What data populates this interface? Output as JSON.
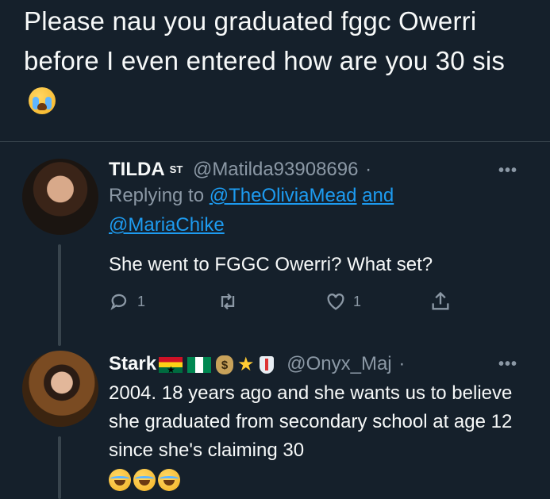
{
  "top_tweet": {
    "text": "Please nau you graduated fggc Owerri before I even entered how are you 30 sis"
  },
  "reply1": {
    "name": "TILDA",
    "badge": "ST",
    "handle": "@Matilda93908696",
    "dot": "·",
    "replying_prefix": "Replying to",
    "mention1": "@TheOliviaMead",
    "and_text": "and",
    "mention2": "@MariaChike",
    "text": "She went to FGGC Owerri? What set?",
    "reply_count": "1",
    "like_count": "1"
  },
  "reply2": {
    "name": "Stark",
    "handle": "@Onyx_Maj",
    "dot": "·",
    "bag_symbol": "$",
    "text": "2004. 18 years ago and she wants us to believe she graduated  from secondary school at age 12  since she's claiming 30"
  },
  "more_icon": "•••",
  "icons": [
    "crying-face-emoji",
    "more-icon",
    "reply-icon",
    "retweet-icon",
    "like-icon",
    "share-icon",
    "ghana-flag",
    "nigeria-flag",
    "money-bag-icon",
    "star-icon",
    "shield-icon",
    "laughing-face-emoji"
  ],
  "colors": {
    "background": "#15202b",
    "text": "#f7f9f9",
    "secondary": "#8b98a5",
    "link": "#1d9bf0",
    "divider": "#38444d"
  }
}
